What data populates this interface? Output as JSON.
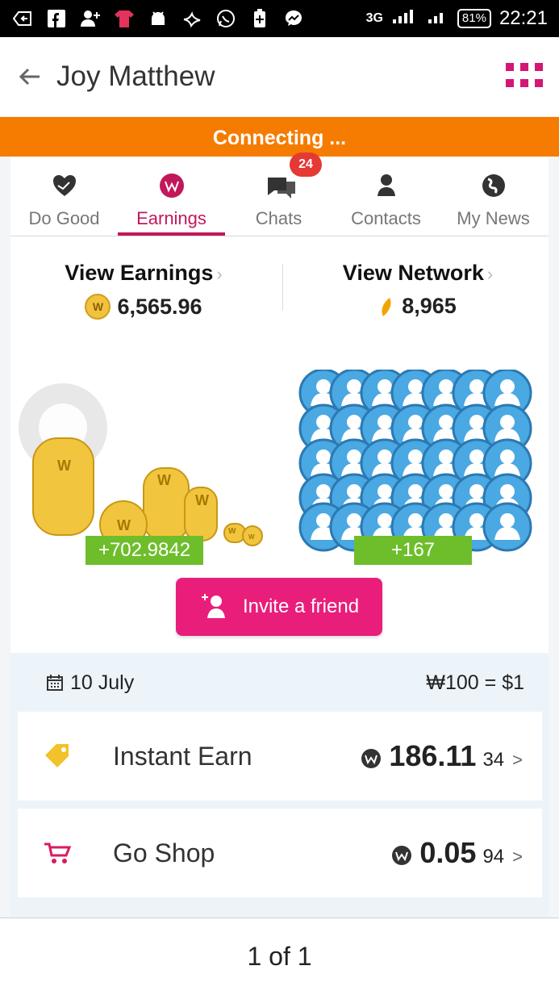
{
  "status_bar": {
    "network_label": "3G",
    "battery": "81%",
    "time": "22:21"
  },
  "header": {
    "title": "Joy Matthew"
  },
  "connection": {
    "label": "Connecting ..."
  },
  "tabs": [
    {
      "label": "Do Good",
      "icon": "heart-hands-icon"
    },
    {
      "label": "Earnings",
      "icon": "w-coin-icon"
    },
    {
      "label": "Chats",
      "icon": "chat-bubbles-icon",
      "badge": "24"
    },
    {
      "label": "Contacts",
      "icon": "person-icon"
    },
    {
      "label": "My News",
      "icon": "globe-icon"
    }
  ],
  "summary": {
    "earnings": {
      "title": "View Earnings",
      "value": "6,565.96",
      "coin": "W"
    },
    "network": {
      "title": "View Network",
      "value": "8,965"
    }
  },
  "visuals": {
    "earnings_delta": "+702.9842",
    "network_delta": "+167"
  },
  "invite": {
    "label": "Invite a friend"
  },
  "panel": {
    "date": "10 July",
    "rate": "₩100 = $1",
    "items": [
      {
        "label": "Instant Earn",
        "value": "186.11",
        "subvalue": "34",
        "icon": "tag-icon"
      },
      {
        "label": "Go Shop",
        "value": "0.05",
        "subvalue": "94",
        "icon": "cart-icon"
      }
    ]
  },
  "footer": {
    "label": "1 of 1"
  },
  "colors": {
    "accent": "#c2185b",
    "orange": "#f57c00",
    "green": "#6ebe2c",
    "pink": "#e91e7b",
    "blue": "#4aa8e3"
  }
}
